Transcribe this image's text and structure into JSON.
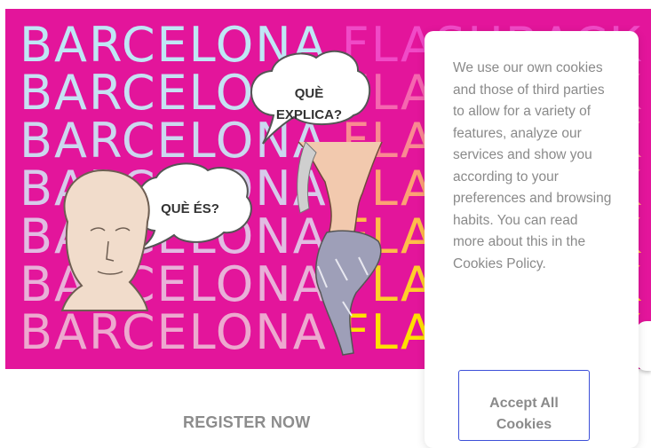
{
  "hero": {
    "word_left": "BARCELONA",
    "word_right": "FLASHBACK",
    "bubble_1": [
      "QUÈ",
      "EXPLICA?"
    ],
    "bubble_2": "QUÈ ÉS?",
    "colors": {
      "background": "#e3159b",
      "left_row_colors": [
        "#bfe7f5",
        "#c6e2f3",
        "#cbd8ef",
        "#d6cbea",
        "#e1bce2",
        "#e8b1d8",
        "#eda9cf"
      ],
      "right_row_colors": [
        "#f04ac7",
        "#f567b0",
        "#f98a92",
        "#fca274",
        "#ffbc4a",
        "#ffcf2a",
        "#ffe000"
      ]
    }
  },
  "register": {
    "label": "REGISTER NOW"
  },
  "cookie": {
    "text": "We use our own cookies and those of third parties to allow for a variety of features, analyze our services and show you according to your preferences and browsing habits. You can read more about this in the Cookies Policy.",
    "accept_label": "Accept All Cookies",
    "accent": "#3c4fd8"
  }
}
